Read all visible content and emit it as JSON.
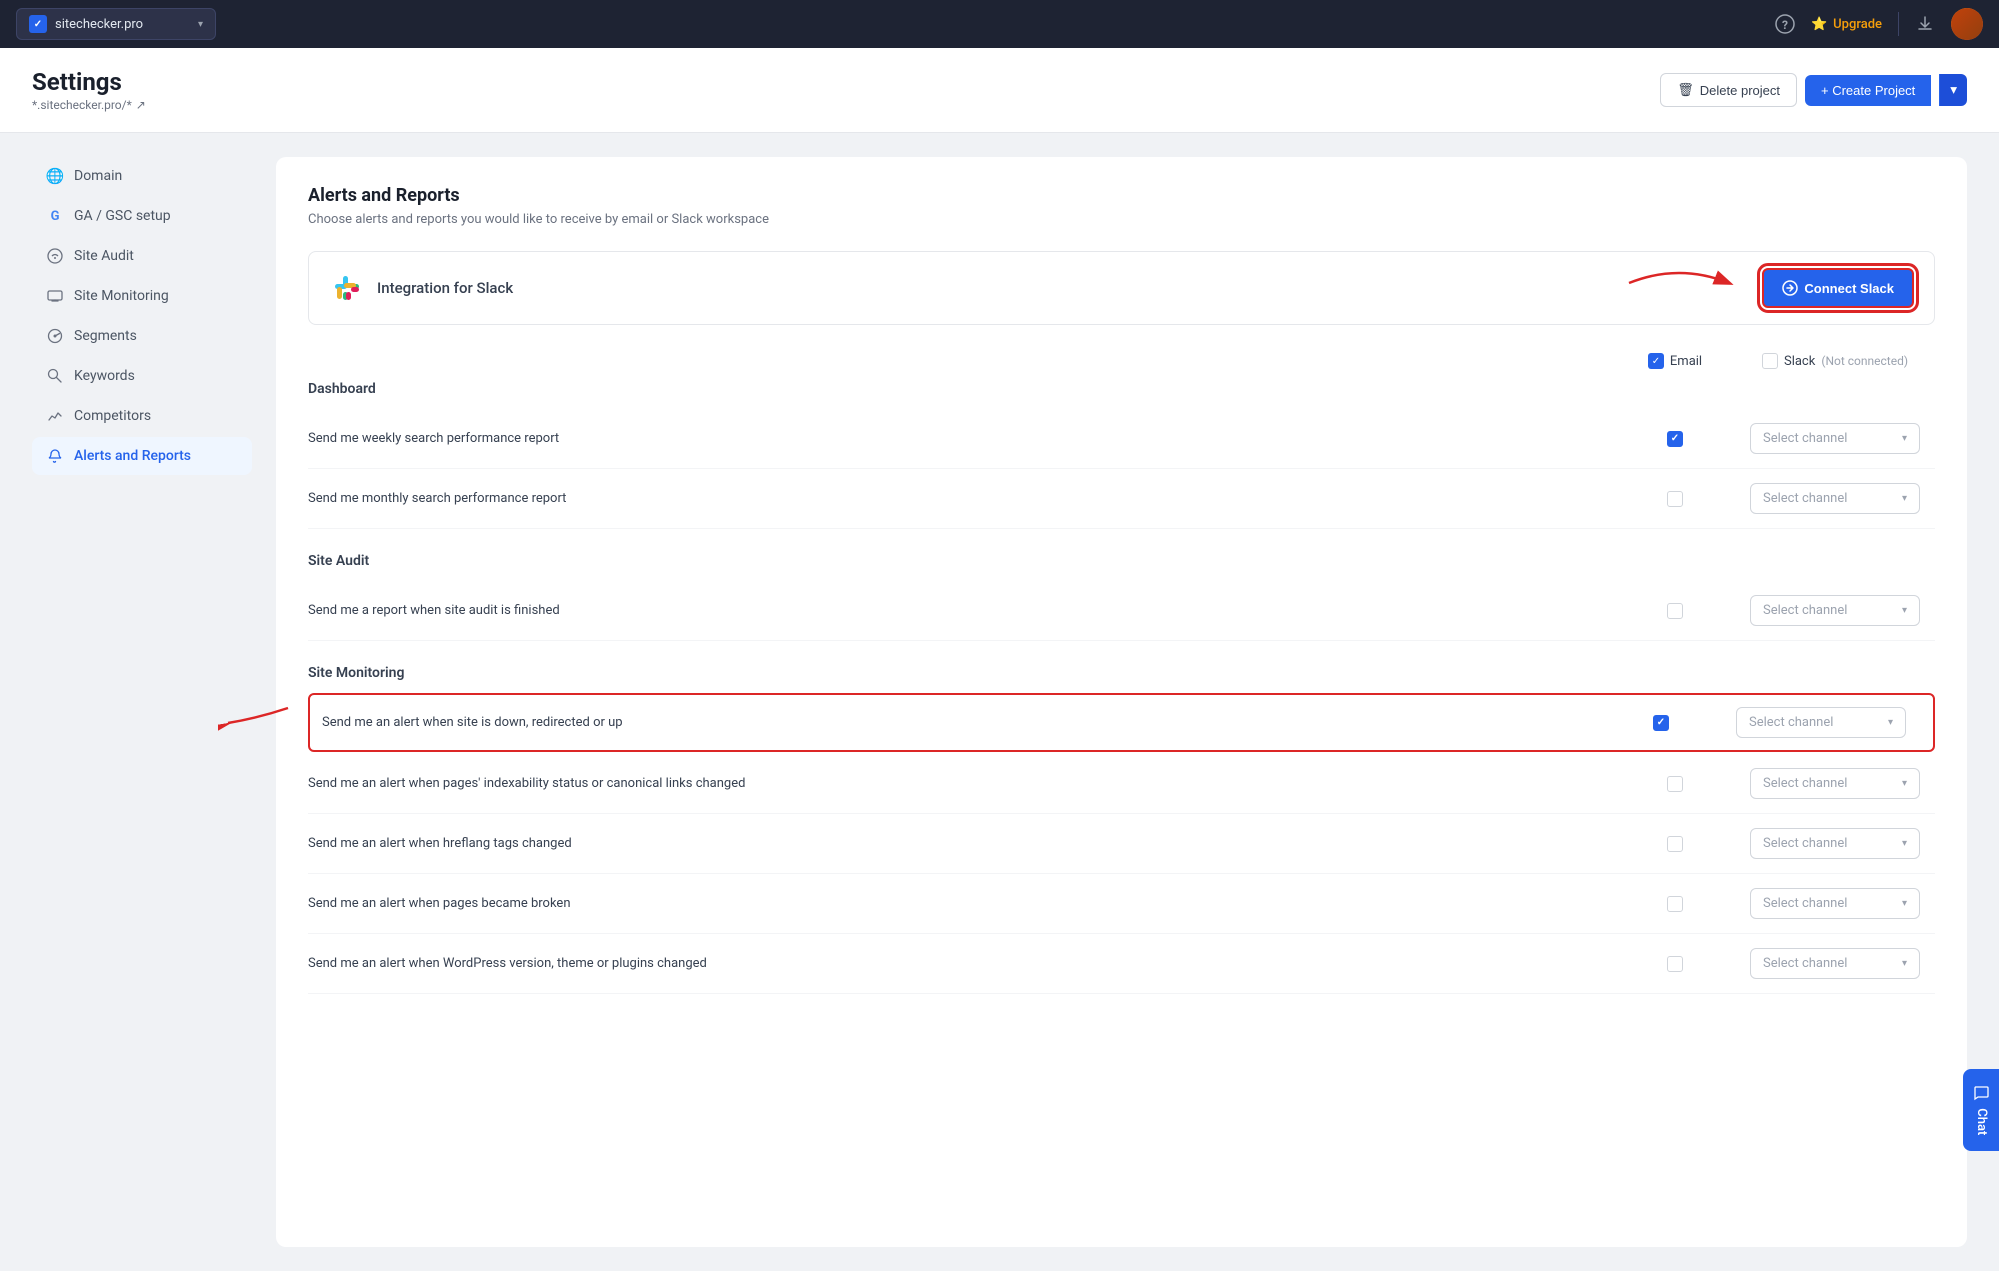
{
  "topNav": {
    "siteSelector": {
      "label": "sitechecker.pro",
      "arrowIcon": "▾"
    },
    "helpIcon": "?",
    "upgradeLabel": "Upgrade",
    "downloadIcon": "↓"
  },
  "pageHeader": {
    "title": "Settings",
    "breadcrumb": "*.sitechecker.pro/*",
    "breadcrumbIcon": "↗",
    "deleteBtn": "Delete project",
    "createBtn": "+ Create Project",
    "createArrow": "▾"
  },
  "sidebar": {
    "items": [
      {
        "id": "domain",
        "label": "Domain",
        "icon": "🌐"
      },
      {
        "id": "ga-gsc",
        "label": "GA / GSC setup",
        "icon": "G"
      },
      {
        "id": "site-audit",
        "label": "Site Audit",
        "icon": "🔧"
      },
      {
        "id": "site-monitoring",
        "label": "Site Monitoring",
        "icon": "📋"
      },
      {
        "id": "segments",
        "label": "Segments",
        "icon": "⏱"
      },
      {
        "id": "keywords",
        "label": "Keywords",
        "icon": "🔑"
      },
      {
        "id": "competitors",
        "label": "Competitors",
        "icon": "📊"
      },
      {
        "id": "alerts",
        "label": "Alerts and Reports",
        "icon": "🔔",
        "active": true
      }
    ]
  },
  "content": {
    "title": "Alerts and Reports",
    "subtitle": "Choose alerts and reports you would like to receive by email or Slack workspace",
    "slackCard": {
      "label": "Integration for Slack",
      "connectBtn": "Connect Slack"
    },
    "columnHeaders": {
      "email": "Email",
      "slack": "Slack",
      "notConnected": "(Not connected)"
    },
    "sections": [
      {
        "id": "dashboard",
        "title": "Dashboard",
        "rows": [
          {
            "id": "weekly-search",
            "label": "Send me weekly search performance report",
            "emailChecked": true,
            "slackChannel": "Select channel",
            "highlighted": false
          },
          {
            "id": "monthly-search",
            "label": "Send me monthly search performance report",
            "emailChecked": false,
            "slackChannel": "Select channel",
            "highlighted": false
          }
        ]
      },
      {
        "id": "site-audit",
        "title": "Site Audit",
        "rows": [
          {
            "id": "audit-finished",
            "label": "Send me a report when site audit is finished",
            "emailChecked": false,
            "slackChannel": "Select channel",
            "highlighted": false
          }
        ]
      },
      {
        "id": "site-monitoring",
        "title": "Site Monitoring",
        "rows": [
          {
            "id": "site-down",
            "label": "Send me an alert when site is down, redirected or up",
            "emailChecked": true,
            "slackChannel": "Select channel",
            "highlighted": true
          },
          {
            "id": "indexability",
            "label": "Send me an alert when pages' indexability status or canonical links changed",
            "emailChecked": false,
            "slackChannel": "Select channel",
            "highlighted": false
          },
          {
            "id": "hreflang",
            "label": "Send me an alert when hreflang tags changed",
            "emailChecked": false,
            "slackChannel": "Select channel",
            "highlighted": false
          },
          {
            "id": "broken-pages",
            "label": "Send me an alert when pages became broken",
            "emailChecked": false,
            "slackChannel": "Select channel",
            "highlighted": false
          },
          {
            "id": "wordpress-version",
            "label": "Send me an alert when WordPress version, theme or plugins changed",
            "emailChecked": false,
            "slackChannel": "Select channel",
            "highlighted": false
          }
        ]
      }
    ]
  },
  "chat": {
    "label": "Chat"
  }
}
